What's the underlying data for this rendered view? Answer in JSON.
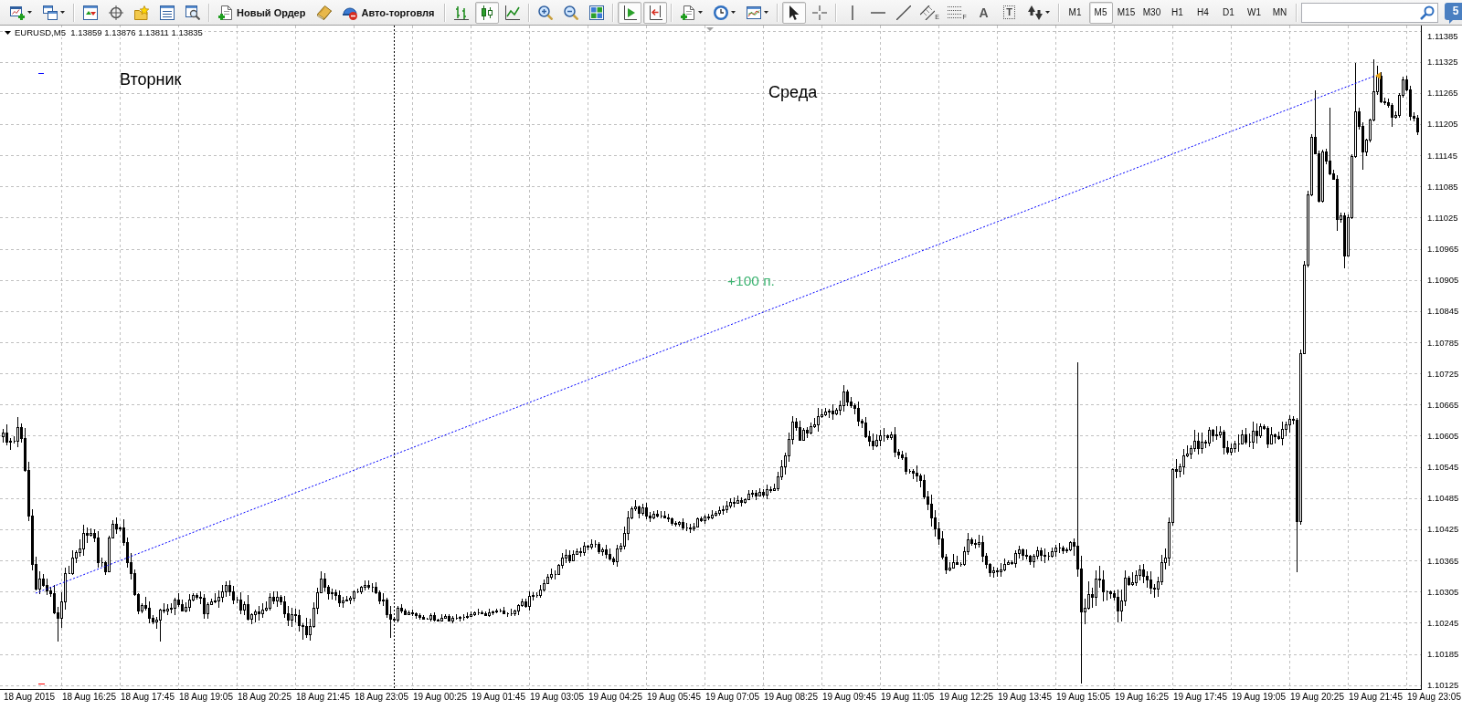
{
  "toolbar": {
    "order_button": {
      "label": "Новый Ордер"
    },
    "autotrading_button": {
      "label": "Авто-торговля",
      "on": false
    },
    "chart_types": [
      {
        "kind": "bars",
        "selected": false
      },
      {
        "kind": "candles",
        "selected": true
      },
      {
        "kind": "line",
        "selected": false
      }
    ],
    "auto_scroll": {
      "on": true
    },
    "chart_shift": {
      "on": true
    },
    "cursor_tools": [
      {
        "kind": "cursor",
        "selected": true
      },
      {
        "kind": "crosshair",
        "selected": false
      }
    ],
    "drawing_tools": [
      {
        "kind": "vline"
      },
      {
        "kind": "hline"
      },
      {
        "kind": "trendline"
      },
      {
        "kind": "channel",
        "letter": "E"
      },
      {
        "kind": "fibo",
        "letter": "F"
      },
      {
        "kind": "text",
        "letter": "A"
      },
      {
        "kind": "label",
        "letter": "T"
      },
      {
        "kind": "arrows"
      }
    ],
    "timeframes": [
      {
        "label": "M1",
        "selected": false
      },
      {
        "label": "M5",
        "selected": true
      },
      {
        "label": "M15",
        "selected": false
      },
      {
        "label": "M30",
        "selected": false
      },
      {
        "label": "H1",
        "selected": false
      },
      {
        "label": "H4",
        "selected": false
      },
      {
        "label": "D1",
        "selected": false
      },
      {
        "label": "W1",
        "selected": false
      },
      {
        "label": "MN",
        "selected": false
      }
    ],
    "community_button": {
      "label": "5"
    }
  },
  "chart": {
    "header": "EURUSD,M5  1.13859 1.13876 1.13811 1.13835",
    "text_objects": [
      {
        "text": "Вторник",
        "color": "#000000"
      },
      {
        "text": "Среда",
        "color": "#000000"
      },
      {
        "text": "+100 п.",
        "color": "#3cb371"
      }
    ],
    "price_axis": [
      "1.11385",
      "1.11325",
      "1.11265",
      "1.11205",
      "1.11145",
      "1.11085",
      "1.11025",
      "1.10965",
      "1.10905",
      "1.10845",
      "1.10785",
      "1.10725",
      "1.10665",
      "1.10605",
      "1.10545",
      "1.10485",
      "1.10425",
      "1.10365",
      "1.10305",
      "1.10245",
      "1.10185",
      "1.10125"
    ],
    "time_axis": [
      "18 Aug 2015",
      "18 Aug 16:25",
      "18 Aug 17:45",
      "18 Aug 19:05",
      "18 Aug 20:25",
      "18 Aug 21:45",
      "18 Aug 23:05",
      "19 Aug 00:25",
      "19 Aug 01:45",
      "19 Aug 03:05",
      "19 Aug 04:25",
      "19 Aug 05:45",
      "19 Aug 07:05",
      "19 Aug 08:25",
      "19 Aug 09:45",
      "19 Aug 11:05",
      "19 Aug 12:25",
      "19 Aug 13:45",
      "19 Aug 15:05",
      "19 Aug 16:25",
      "19 Aug 17:45",
      "19 Aug 19:05",
      "19 Aug 20:25",
      "19 Aug 21:45",
      "19 Aug 23:05"
    ]
  }
}
